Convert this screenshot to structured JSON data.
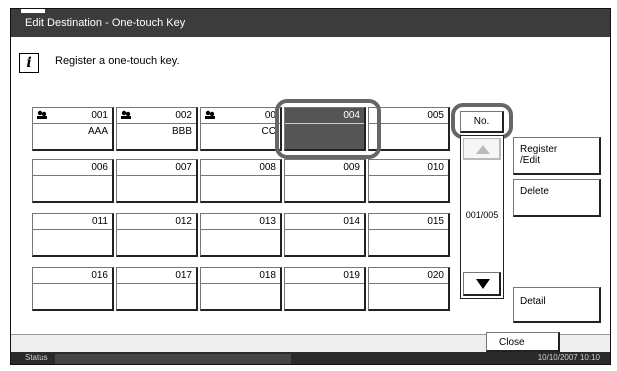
{
  "window": {
    "title": "Edit Destination - One-touch Key"
  },
  "message": {
    "text": "Register a one-touch key."
  },
  "keys": [
    {
      "number": "001",
      "name": "AAA",
      "group": true
    },
    {
      "number": "002",
      "name": "BBB",
      "group": true
    },
    {
      "number": "00",
      "name": "CC",
      "group": true
    },
    {
      "number": "004",
      "name": "",
      "group": false,
      "selected": true
    },
    {
      "number": "005",
      "name": "",
      "group": false
    },
    {
      "number": "006",
      "name": "",
      "group": false
    },
    {
      "number": "007",
      "name": "",
      "group": false
    },
    {
      "number": "008",
      "name": "",
      "group": false
    },
    {
      "number": "009",
      "name": "",
      "group": false
    },
    {
      "number": "010",
      "name": "",
      "group": false
    },
    {
      "number": "011",
      "name": "",
      "group": false
    },
    {
      "number": "012",
      "name": "",
      "group": false
    },
    {
      "number": "013",
      "name": "",
      "group": false
    },
    {
      "number": "014",
      "name": "",
      "group": false
    },
    {
      "number": "015",
      "name": "",
      "group": false
    },
    {
      "number": "016",
      "name": "",
      "group": false
    },
    {
      "number": "017",
      "name": "",
      "group": false
    },
    {
      "number": "018",
      "name": "",
      "group": false
    },
    {
      "number": "019",
      "name": "",
      "group": false
    },
    {
      "number": "020",
      "name": "",
      "group": false
    }
  ],
  "controls": {
    "no_label": "No.",
    "page_indicator": "001/005",
    "register_edit_line1": "Register",
    "register_edit_line2": "/Edit",
    "delete_label": "Delete",
    "detail_label": "Detail",
    "close_label": "Close"
  },
  "status": {
    "label": "Status",
    "datetime": "10/10/2007   10:10"
  },
  "colors": {
    "titlebar": "#3c3c3c",
    "selected_key": "#555555",
    "statusbar": "#2a2a2a"
  }
}
